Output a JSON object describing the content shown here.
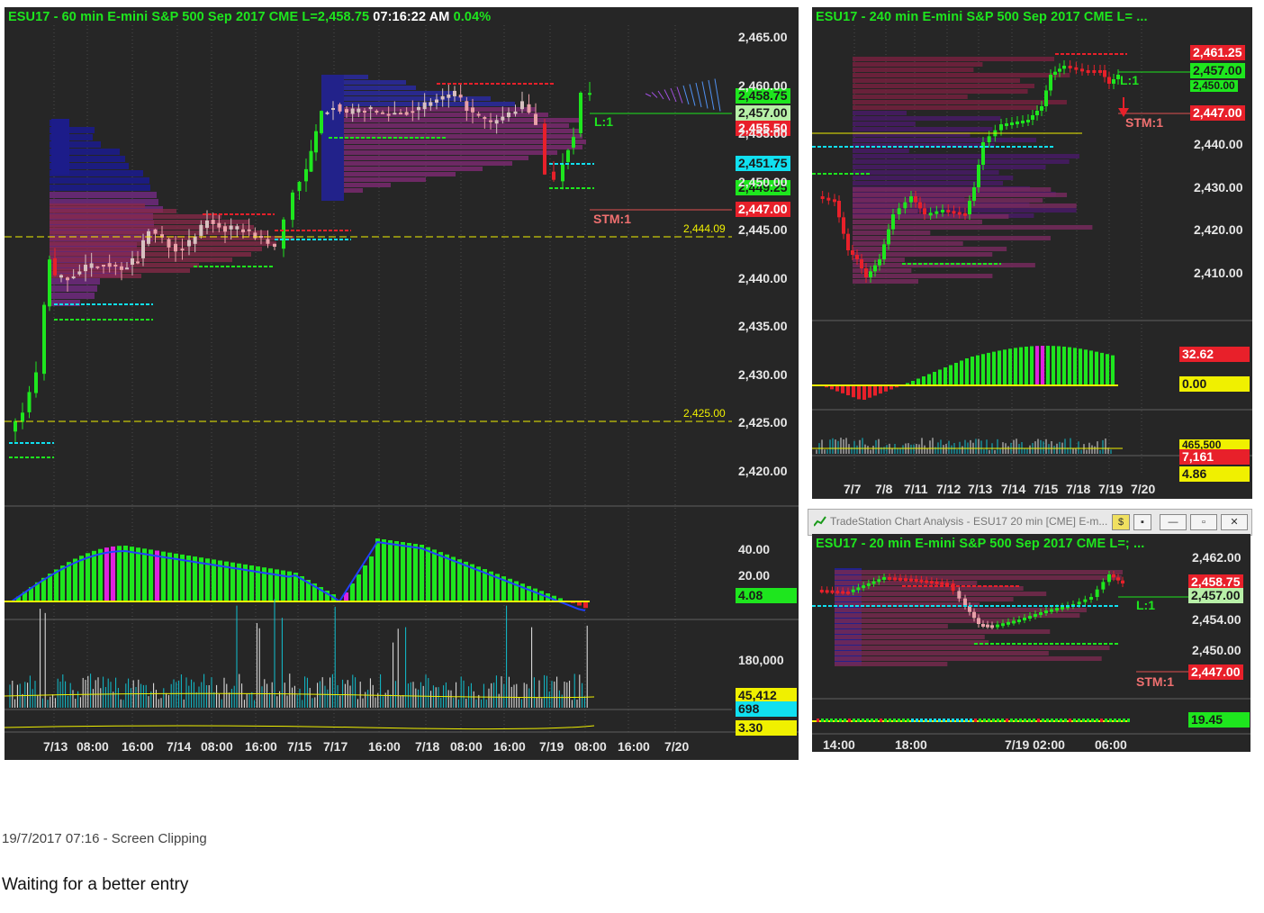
{
  "main": {
    "title": {
      "symbol": "ESU17 - 60 min  E-mini S&P 500 Sep 2017  CME  L=2,458.75",
      "time": "07:16:22 AM",
      "change": "0.04%"
    },
    "price_axis": [
      "2,465.00",
      "2,460.00",
      "2,455.00",
      "2,450.00",
      "2,445.00",
      "2,440.00",
      "2,435.00",
      "2,430.00",
      "2,425.00",
      "2,420.00"
    ],
    "tags": {
      "last": "2,458.75",
      "entry": "2,457.00",
      "stop_upper": "2,455.50",
      "cyan_level": "2,451.75",
      "green_level": "2,449.25",
      "stop": "2,447.00"
    },
    "labels": {
      "l1": "L:1",
      "stm": "STM:1",
      "line_a": "2,444.09",
      "line_b": "2,425.00"
    },
    "osc_axis": [
      "40.00",
      "20.00"
    ],
    "osc_tag": "4.08",
    "vol_axis": "180,000",
    "vol_tags": {
      "a": "45,412",
      "b": "698",
      "c": "3.30"
    },
    "x_axis": [
      "7/13",
      "08:00",
      "16:00",
      "7/14",
      "08:00",
      "16:00",
      "7/15",
      "7/17",
      "16:00",
      "7/18",
      "08:00",
      "16:00",
      "7/19",
      "08:00",
      "16:00",
      "7/20"
    ]
  },
  "right_top": {
    "title": "ESU17 - 240 min  E-mini S&P 500 Sep 2017  CME  L= ...",
    "price_axis": [
      "2,440.00",
      "2,430.00",
      "2,420.00",
      "2,410.00"
    ],
    "tags": {
      "t1": "2,461.25",
      "t2": "2,457.00",
      "t3": "2,450.00",
      "stop": "2,447.00"
    },
    "labels": {
      "l1": "L:1",
      "stm": "STM:1"
    },
    "osc_tags": {
      "a": "32.62",
      "b": "0.00"
    },
    "vol_tags": {
      "a": "465,500",
      "b": "7,161",
      "c": "4.86"
    },
    "x_axis": [
      "7/7",
      "7/8",
      "7/11",
      "7/12",
      "7/13",
      "7/14",
      "7/15",
      "7/18",
      "7/19",
      "7/20"
    ]
  },
  "right_bottom": {
    "window_title": "TradeStation Chart Analysis - ESU17 20 min [CME] E-m...",
    "title": "ESU17 - 20 min  E-mini S&P 500 Sep 2017  CME  L=; ...",
    "price_axis": [
      "2,462.00",
      "2,454.00",
      "2,450.00"
    ],
    "tags": {
      "last": "2,458.75",
      "entry": "2,457.00",
      "stop": "2,447.00",
      "osc": "19.45"
    },
    "labels": {
      "l1": "L:1",
      "stm": "STM:1"
    },
    "x_axis": [
      "14:00",
      "18:00",
      "7/19 02:00",
      "06:00"
    ]
  },
  "caption": "19/7/2017 07:16 - Screen Clipping",
  "note": "Waiting for a better entry",
  "colors": {
    "bg": "#262626",
    "green": "#1ee61e",
    "red": "#e8202a",
    "cyan": "#10e0f0",
    "yellow": "#f0f000",
    "magenta": "#e020e0"
  }
}
